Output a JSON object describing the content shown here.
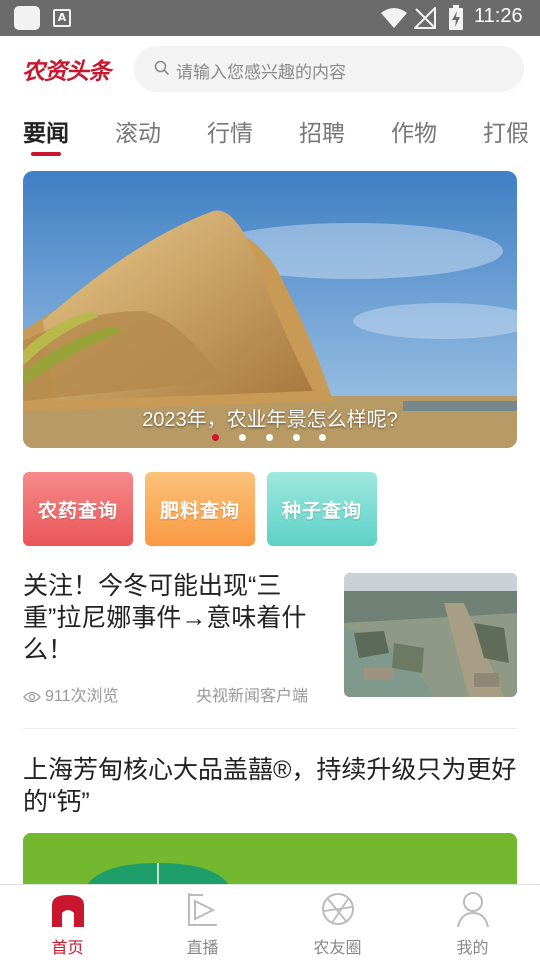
{
  "status_bar": {
    "time": "11:26",
    "app_badge": "A"
  },
  "header": {
    "logo_text": "农资头条",
    "search": {
      "placeholder": "请输入您感兴趣的内容"
    }
  },
  "tabs": [
    {
      "label": "要闻",
      "active": true
    },
    {
      "label": "滚动",
      "active": false
    },
    {
      "label": "行情",
      "active": false
    },
    {
      "label": "招聘",
      "active": false
    },
    {
      "label": "作物",
      "active": false
    },
    {
      "label": "打假",
      "active": false
    }
  ],
  "banner": {
    "caption": "2023年，农业年景怎么样呢?",
    "slide_count": 5,
    "current_slide": 1
  },
  "quick_links": [
    {
      "label": "农药查询",
      "color": "#ea5558"
    },
    {
      "label": "肥料查询",
      "color": "#f99941"
    },
    {
      "label": "种子查询",
      "color": "#5dd1c6"
    }
  ],
  "news": [
    {
      "title": "关注！今冬可能出现“三重”拉尼娜事件→意味着什么！",
      "views": "911次浏览",
      "source": "央视新闻客户端"
    },
    {
      "title": "上海芳甸核心大品盖囍®，持续升级只为更好的“钙”"
    }
  ],
  "bottom_nav": [
    {
      "label": "首页",
      "icon": "home-icon",
      "active": true
    },
    {
      "label": "直播",
      "icon": "live-icon",
      "active": false
    },
    {
      "label": "农友圈",
      "icon": "community-icon",
      "active": false
    },
    {
      "label": "我的",
      "icon": "profile-icon",
      "active": false
    }
  ],
  "colors": {
    "brand_red": "#c8172e",
    "active_dot": "#d0142c"
  }
}
